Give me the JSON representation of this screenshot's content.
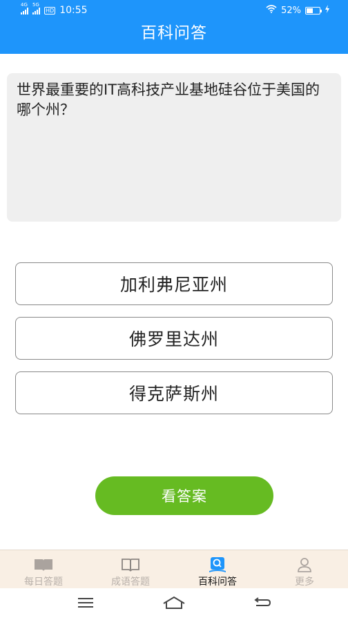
{
  "status_bar": {
    "network_1": "4G",
    "network_2": "5G",
    "hd": "HD",
    "time": "10:55",
    "battery_text": "52%",
    "battery_level": 0.52
  },
  "header": {
    "title": "百科问答"
  },
  "question": {
    "text": "世界最重要的IT高科技产业基地硅谷位于美国的哪个州？"
  },
  "options": [
    {
      "label": "加利弗尼亚州"
    },
    {
      "label": "佛罗里达州"
    },
    {
      "label": "得克萨斯州"
    }
  ],
  "answer_button": {
    "label": "看答案"
  },
  "tabs": [
    {
      "label": "每日答题",
      "icon": "open-book-icon"
    },
    {
      "label": "成语答题",
      "icon": "book-outline-icon"
    },
    {
      "label": "百科问答",
      "icon": "encyclopedia-icon",
      "active": true
    },
    {
      "label": "更多",
      "icon": "person-icon"
    }
  ],
  "colors": {
    "header": "#1e95fb",
    "answer_button": "#66bb22",
    "tabbar_bg": "#f9efe4",
    "active_icon": "#1e95fb"
  }
}
